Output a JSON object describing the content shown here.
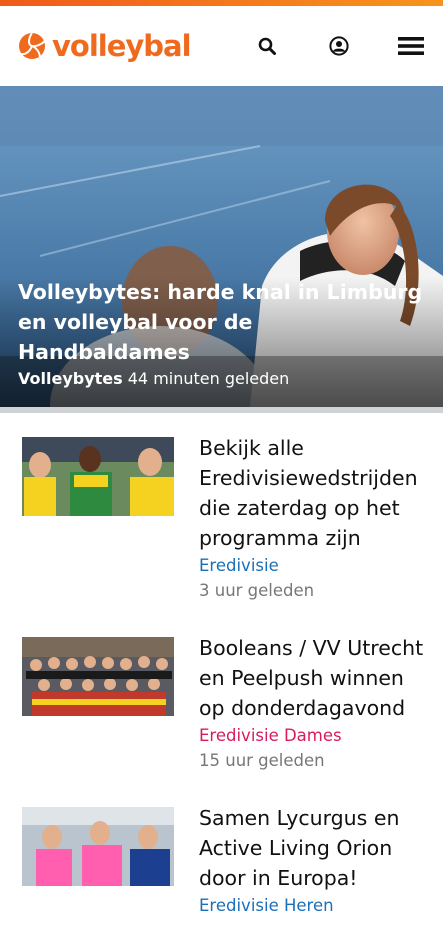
{
  "colors": {
    "brand_orange": "#f06a1e",
    "category_blue": "#1b6fb8",
    "category_pink": "#d81b60",
    "time_grey": "#777777"
  },
  "header": {
    "logo_text": "volleybal",
    "icons": [
      "search-icon",
      "user-icon",
      "menu-icon"
    ]
  },
  "hero": {
    "title": "Volleybytes: harde knal in Limburg en volleybal voor de Handbaldames",
    "category": "Volleybytes",
    "time": "44 minuten geleden"
  },
  "articles": [
    {
      "title": "Bekijk alle Eredivisiewedstrijden die zaterdag op het programma zijn",
      "category": "Eredivisie",
      "category_color": "#1b6fb8",
      "time": "3 uur geleden"
    },
    {
      "title": "Booleans / VV Utrecht en Peelpush winnen op donderdagavond",
      "category": "Eredivisie Dames",
      "category_color": "#d81b60",
      "time": "15 uur geleden"
    },
    {
      "title": "Samen Lycurgus en Active Living Orion door in Europa!",
      "category": "Eredivisie Heren",
      "category_color": "#1b6fb8",
      "time": ""
    }
  ]
}
